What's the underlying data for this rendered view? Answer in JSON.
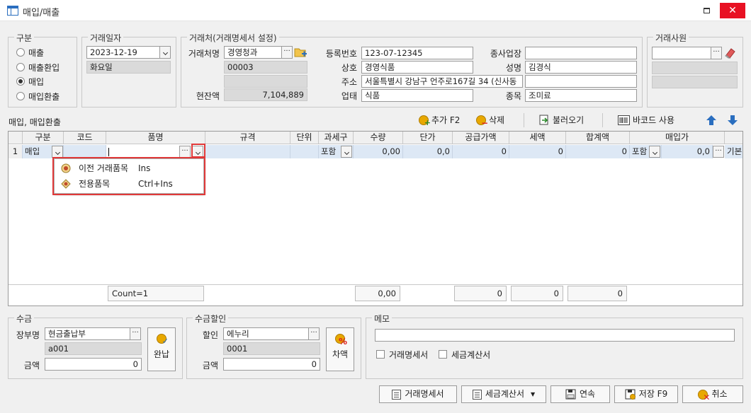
{
  "window": {
    "title": "매입/매출",
    "close_glyph": "✕"
  },
  "type_group": {
    "legend": "구분",
    "options": [
      "매출",
      "매출환입",
      "매입",
      "매입환출"
    ],
    "selected": "매입"
  },
  "date_group": {
    "legend": "거래일자",
    "date": "2023-12-19",
    "weekday": "화요일"
  },
  "client_group": {
    "legend": "거래처(거래명세서 설정)",
    "name_label": "거래처명",
    "name": "경영청과",
    "code": "00003",
    "balance_label": "현잔액",
    "balance": "7,104,889",
    "reg_label": "등록번호",
    "reg_no": "123-07-12345",
    "company_label": "상호",
    "company": "경영식품",
    "address_label": "주소",
    "address": "서울특별시 강남구 언주로167길 34 (신사동",
    "business_label": "업태",
    "business": "식품",
    "branch_label": "종사업장",
    "branch": "",
    "owner_label": "성명",
    "owner": "김경식",
    "item_label": "종목",
    "item": "조미료"
  },
  "staff_group": {
    "legend": "거래사원",
    "value": ""
  },
  "section_label": "매입, 매입환출",
  "toolbar": {
    "add": "추가 F2",
    "delete": "삭제",
    "load": "불러오기",
    "barcode": "바코드 사용"
  },
  "grid": {
    "headers": [
      "",
      "구분",
      "코드",
      "품명",
      "규격",
      "단위",
      "과세구",
      "수량",
      "단가",
      "공급가액",
      "세액",
      "합계액",
      "매입가",
      ""
    ],
    "row": {
      "no": "1",
      "type": "매입",
      "code": "",
      "name": "",
      "spec": "",
      "unit": "",
      "tax": "포함",
      "qty": "0,00",
      "price": "0,0",
      "supply": "0",
      "vat": "0",
      "total": "0",
      "pur_tax": "포함",
      "pur_price": "0,0",
      "extra": "기본"
    },
    "footer": {
      "count": "Count=1",
      "qty": "0,00",
      "supply": "0",
      "vat": "0",
      "total": "0"
    }
  },
  "popup": {
    "items": [
      {
        "label": "이전 거래품목",
        "shortcut": "Ins"
      },
      {
        "label": "전용품목",
        "shortcut": "Ctrl+Ins"
      }
    ]
  },
  "receipt": {
    "legend": "수금",
    "ledger_label": "장부명",
    "ledger": "현금출납부",
    "code": "a001",
    "amount_label": "금액",
    "amount": "0",
    "button": "완납"
  },
  "discount": {
    "legend": "수금할인",
    "label": "할인",
    "value": "에누리",
    "code": "0001",
    "amount_label": "금액",
    "amount": "0",
    "button": "차액"
  },
  "memo": {
    "legend": "메모",
    "value": "",
    "check1": "거래명세서",
    "check2": "세금계산서"
  },
  "bottom_buttons": {
    "statement": "거래명세서",
    "tax_invoice": "세금계산서",
    "continue": "연속",
    "save": "저장 F9",
    "cancel": "취소"
  },
  "colors": {
    "accent": "#2a6ebf",
    "close": "#e81123",
    "highlight": "#e03838",
    "row": "#dde8f5"
  }
}
